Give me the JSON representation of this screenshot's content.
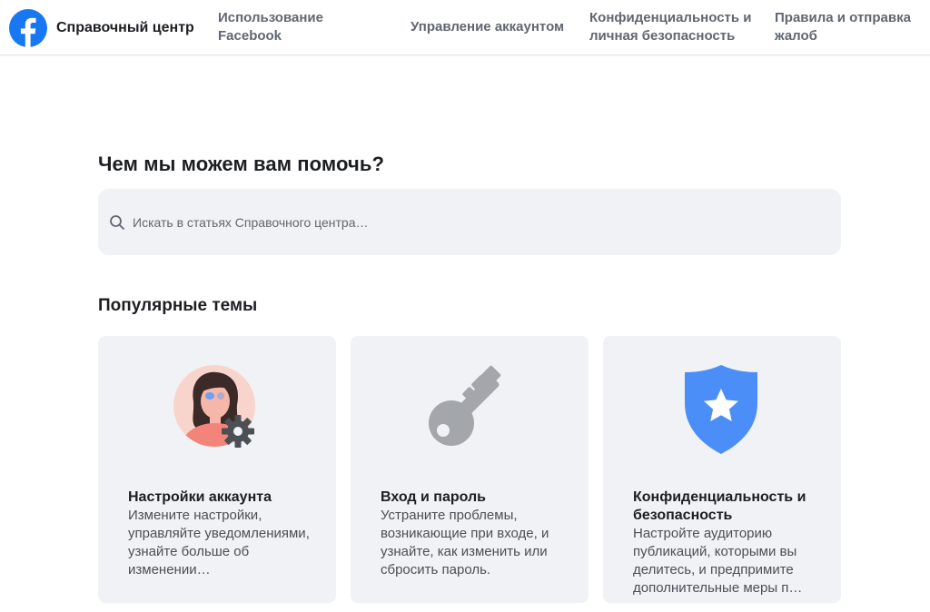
{
  "header": {
    "brand_label": "Справочный центр",
    "nav": [
      {
        "label": "Использование Facebook"
      },
      {
        "label": "Управление аккаунтом"
      },
      {
        "label": "Конфиденциальность и личная безопасность"
      },
      {
        "label": "Правила и отправка жалоб"
      }
    ]
  },
  "main": {
    "title": "Чем мы можем вам помочь?",
    "search": {
      "value": "",
      "placeholder": "Искать в статьях Справочного центра…"
    },
    "popular": {
      "title": "Популярные темы",
      "cards": [
        {
          "title": "Настройки аккаунта",
          "description": "Измените настройки, управляйте уведомлениями, узнайте больше об изменении…",
          "icon": "person-gear-icon"
        },
        {
          "title": "Вход и пароль",
          "description": "Устраните проблемы, возникающие при входе, и узнайте, как изменить или сбросить пароль.",
          "icon": "key-icon"
        },
        {
          "title": "Конфиденциальность и безопасность",
          "description": "Настройте аудиторию публикаций, которыми вы делитесь, и предпримите дополнительные меры п…",
          "icon": "shield-star-icon"
        }
      ]
    }
  },
  "colors": {
    "brand_blue": "#1877f2",
    "card_bg": "#f0f2f5",
    "shield_blue": "#4c8ef7",
    "key_gray": "#a3a6ab",
    "avatar_pink": "#f6a59a",
    "gear_dark": "#4b4f56"
  }
}
